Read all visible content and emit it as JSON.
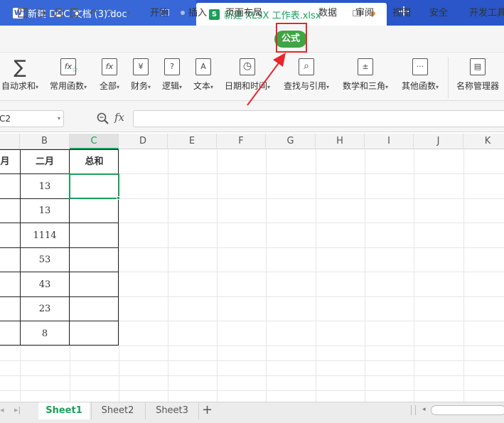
{
  "tabs": [
    {
      "app": "W",
      "title": "新建 DOC 文档 (3).doc"
    },
    {
      "app": "S",
      "title": "新建 XLSX 工作表.xlsx"
    }
  ],
  "new_tab_label": "+",
  "menu": [
    "开始",
    "插入",
    "页面布局",
    "公式",
    "数据",
    "审阅",
    "视图",
    "安全",
    "开发工具"
  ],
  "ribbon": [
    {
      "label": "自动求和",
      "icon": "sum-icon",
      "glyph": "∑"
    },
    {
      "label": "常用函数",
      "icon": "star-function-icon",
      "glyph": "fx"
    },
    {
      "label": "全部",
      "icon": "all-functions-icon",
      "glyph": "fx"
    },
    {
      "label": "财务",
      "icon": "finance-icon",
      "glyph": "¥"
    },
    {
      "label": "逻辑",
      "icon": "logic-icon",
      "glyph": "?"
    },
    {
      "label": "文本",
      "icon": "text-icon",
      "glyph": "A"
    },
    {
      "label": "日期和时间",
      "icon": "clock-icon",
      "glyph": "◷"
    },
    {
      "label": "查找与引用",
      "icon": "lookup-icon",
      "glyph": "⌕"
    },
    {
      "label": "数学和三角",
      "icon": "math-icon",
      "glyph": "±"
    },
    {
      "label": "其他函数",
      "icon": "more-functions-icon",
      "glyph": "···"
    },
    {
      "label": "名称管理器",
      "icon": "name-manager-icon",
      "glyph": "▤"
    }
  ],
  "formula_bar": {
    "name_box": "C2",
    "fx_label": "fx",
    "value": ""
  },
  "columns": [
    "B",
    "C",
    "D",
    "E",
    "F",
    "G",
    "H",
    "I",
    "J",
    "K"
  ],
  "col_a_partial": "月",
  "header_row": {
    "B": "二月",
    "C": "总和"
  },
  "b_values": [
    "13",
    "13",
    "1114",
    "53",
    "43",
    "23",
    "8"
  ],
  "sheets": [
    "Sheet1",
    "Sheet2",
    "Sheet3"
  ],
  "add_sheet_label": "+",
  "colors": {
    "accent": "#1a9f5a",
    "formula_tab": "#3ea543",
    "highlight": "#e8262a",
    "titlebar": "#2b56c9"
  }
}
